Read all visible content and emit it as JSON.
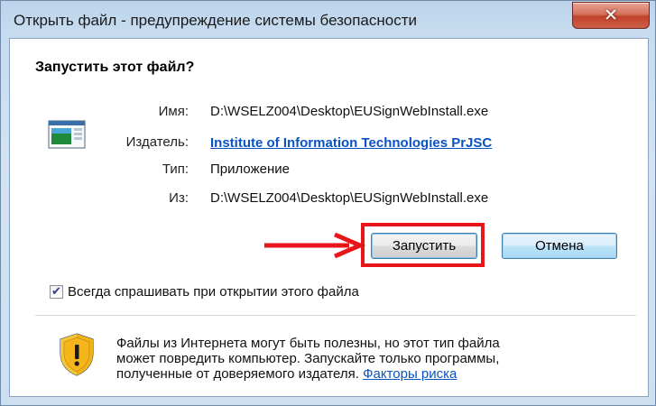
{
  "window": {
    "title": "Открыть файл - предупреждение системы безопасности",
    "close_glyph": "✕"
  },
  "heading": "Запустить этот файл?",
  "fields": {
    "name_label": "Имя:",
    "name_value": "D:\\WSELZ004\\Desktop\\EUSignWebInstall.exe",
    "publisher_label": "Издатель:",
    "publisher_value": "Institute of Information Technologies PrJSC",
    "type_label": "Тип:",
    "type_value": "Приложение",
    "from_label": "Из:",
    "from_value": "D:\\WSELZ004\\Desktop\\EUSignWebInstall.exe"
  },
  "buttons": {
    "run_label": "Запустить",
    "cancel_label": "Отмена"
  },
  "checkbox": {
    "checked": true,
    "label": "Всегда спрашивать при открытии этого файла"
  },
  "warning": {
    "line1": "Файлы из Интернета могут быть полезны, но этот тип файла",
    "line2": "может повредить компьютер. Запускайте только программы,",
    "line3_prefix": "полученные от доверяемого издателя. ",
    "risk_link": "Факторы риска"
  },
  "icons": {
    "app": "application-icon",
    "shield": "security-shield-icon",
    "arrow": "red-arrow-annotation"
  },
  "colors": {
    "link": "#0a52c5",
    "highlight": "#e8151b",
    "close_button": "#c0422b"
  }
}
